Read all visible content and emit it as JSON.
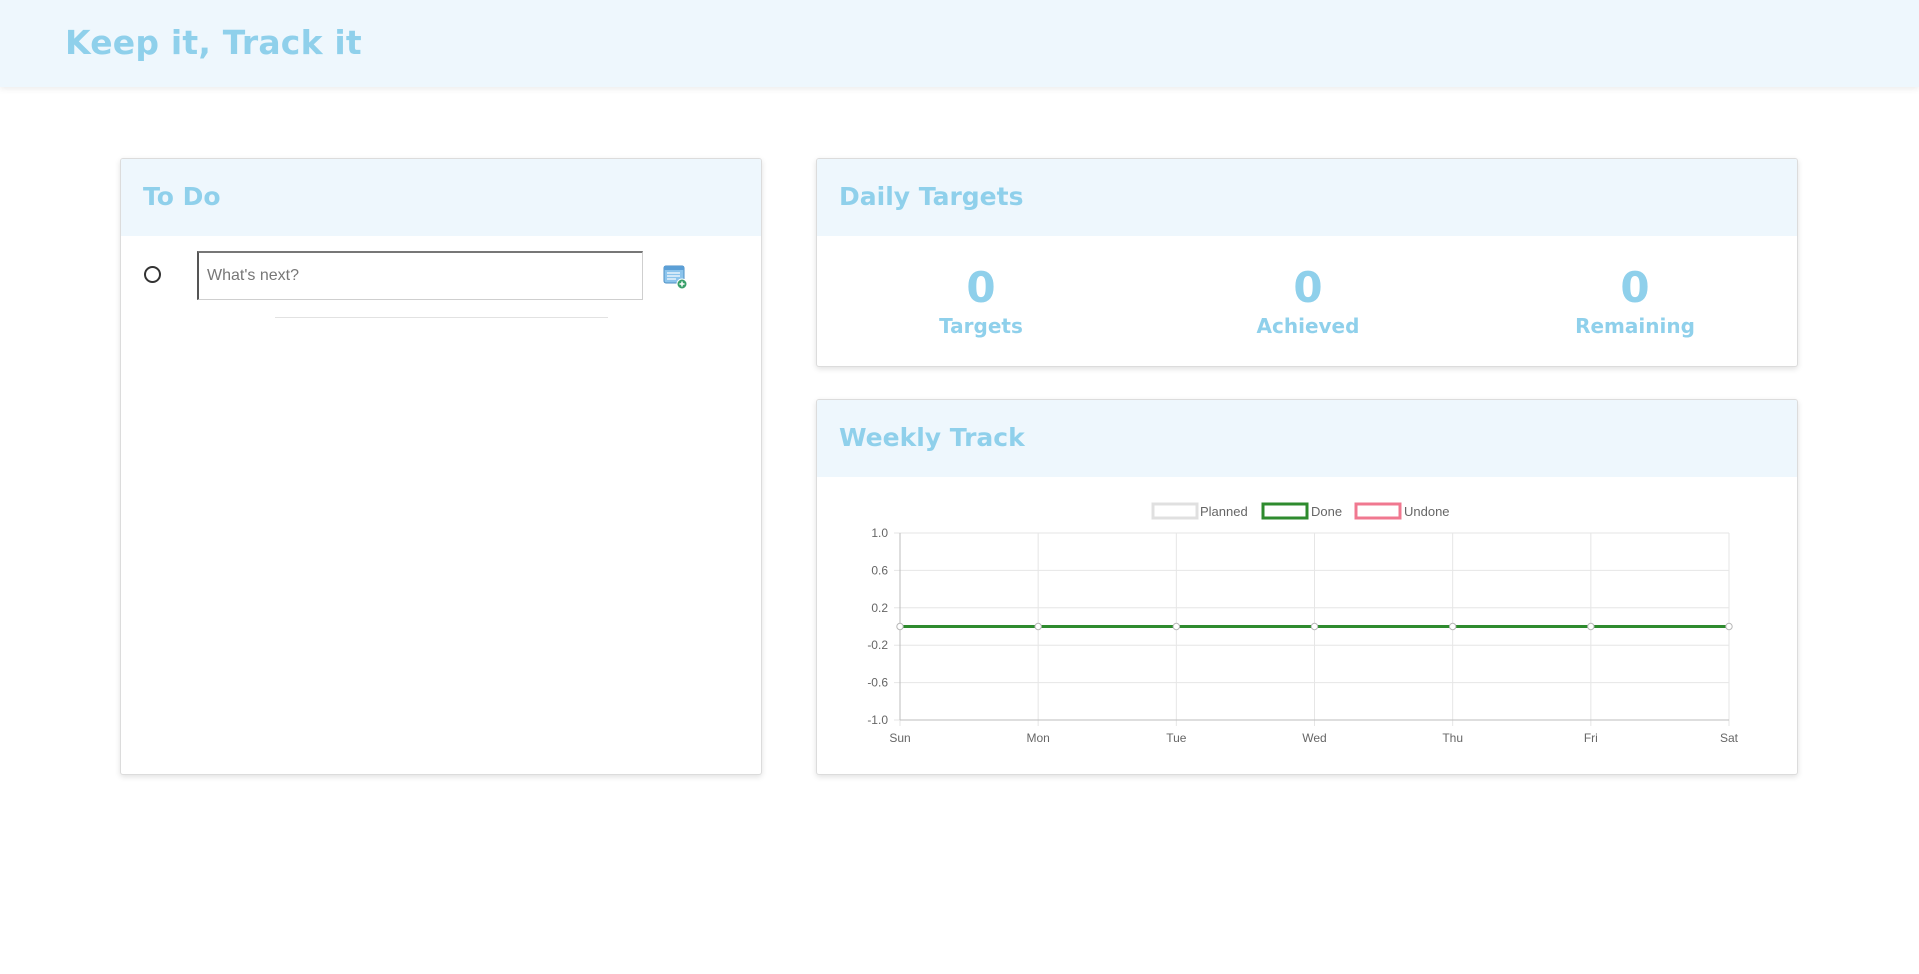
{
  "app": {
    "title": "Keep it, Track it"
  },
  "todo": {
    "title": "To Do",
    "input_placeholder": "What's next?",
    "input_value": "",
    "add_icon": "add-note-icon"
  },
  "daily_targets": {
    "title": "Daily Targets",
    "stats": [
      {
        "value": "0",
        "label": "Targets"
      },
      {
        "value": "0",
        "label": "Achieved"
      },
      {
        "value": "0",
        "label": "Remaining"
      }
    ]
  },
  "weekly_track": {
    "title": "Weekly Track"
  },
  "colors": {
    "accent": "#8fd0eb",
    "header_bg": "#eef7fd",
    "planned": "#e0e0e0",
    "done": "#2e8b2e",
    "undone": "#f07890"
  },
  "chart_data": {
    "type": "line",
    "categories": [
      "Sun",
      "Mon",
      "Tue",
      "Wed",
      "Thu",
      "Fri",
      "Sat"
    ],
    "series": [
      {
        "name": "Planned",
        "values": [
          0,
          0,
          0,
          0,
          0,
          0,
          0
        ],
        "color": "#e0e0e0"
      },
      {
        "name": "Done",
        "values": [
          0,
          0,
          0,
          0,
          0,
          0,
          0
        ],
        "color": "#2e8b2e"
      },
      {
        "name": "Undone",
        "values": [
          0,
          0,
          0,
          0,
          0,
          0,
          0
        ],
        "color": "#f07890"
      }
    ],
    "ylim": [
      -1.0,
      1.0
    ],
    "yticks": [
      "1.0",
      "0.6",
      "0.2",
      "-0.2",
      "-0.6",
      "-1.0"
    ],
    "ytick_values": [
      1.0,
      0.6,
      0.2,
      -0.2,
      -0.6,
      -1.0
    ],
    "grid": true,
    "legend_position": "top"
  }
}
